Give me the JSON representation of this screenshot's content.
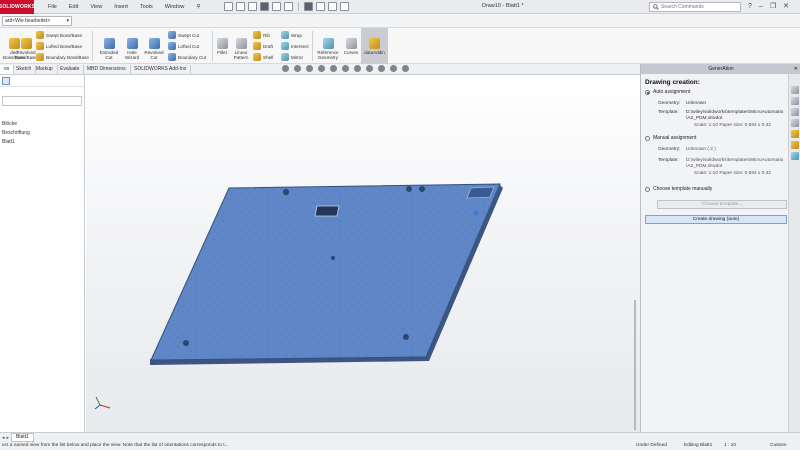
{
  "app": {
    "logo_text": "SOLIDWORKS",
    "menu": [
      "File",
      "Edit",
      "View",
      "Insert",
      "Tools",
      "Window"
    ],
    "pin_glyph": "⚲",
    "doc_title": "Draw10 - Blatt1 *",
    "search_placeholder": "Search Commands",
    "window_controls": [
      "?",
      "–",
      "❐",
      "✕"
    ]
  },
  "config": {
    "current": "ard<Wie bearbeitet>"
  },
  "ribbon": {
    "large": [
      {
        "label": "ded\nBoss/Base",
        "icon": "extrude-icon"
      },
      {
        "label": "Revolved\nBoss/Base",
        "icon": "revolve-icon"
      },
      {
        "label": "Extruded\nCut",
        "icon": "extruded-cut-icon"
      },
      {
        "label": "Hole\nWizard",
        "icon": "hole-wizard-icon"
      },
      {
        "label": "Revolved\nCut",
        "icon": "revolved-cut-icon"
      },
      {
        "label": "Fillet",
        "icon": "fillet-icon"
      },
      {
        "label": "Linear\nPattern",
        "icon": "linear-pattern-icon"
      },
      {
        "label": "Reference\nGeometry",
        "icon": "reference-geometry-icon"
      },
      {
        "label": "Curves",
        "icon": "curves-icon"
      },
      {
        "label": "dataAddin",
        "icon": "addin-icon"
      }
    ],
    "small": [
      {
        "label": "Swept Boss/Base",
        "icon": "swept-boss-icon"
      },
      {
        "label": "Lofted Boss/Base",
        "icon": "lofted-boss-icon"
      },
      {
        "label": "Boundary Boss/Base",
        "icon": "boundary-boss-icon"
      },
      {
        "label": "Swept Cut",
        "icon": "swept-cut-icon"
      },
      {
        "label": "Lofted Cut",
        "icon": "lofted-cut-icon"
      },
      {
        "label": "Boundary Cut",
        "icon": "boundary-cut-icon"
      },
      {
        "label": "Rib",
        "icon": "rib-icon"
      },
      {
        "label": "Draft",
        "icon": "draft-icon"
      },
      {
        "label": "Shell",
        "icon": "shell-icon"
      },
      {
        "label": "Wrap",
        "icon": "wrap-icon"
      },
      {
        "label": "Intersect",
        "icon": "intersect-icon"
      },
      {
        "label": "Mirror",
        "icon": "mirror-icon"
      }
    ]
  },
  "tabs": [
    "es",
    "Sketch",
    "Markup",
    "Evaluate",
    "MBD Dimensions",
    "SOLIDWORKS Add-Ins"
  ],
  "tree": {
    "items": [
      "Blöcke",
      "Beschriftung",
      "Blatt1"
    ]
  },
  "taskpane": {
    "header": "GenerAtion",
    "close_glyph": "✕",
    "title": "Drawing creation:",
    "auto": {
      "label": "Auto assignment",
      "geometry_label": "Geometry:",
      "geometry_value": "Unknown",
      "template_label": "Template:",
      "template_value_1": "D:\\wiley\\solidworks\\templates\\MicroAutomatio",
      "template_value_2": "\\A2_PDM.drwdot",
      "scale": "Scale: 1:10  Paper size: 0.594 x 0.42"
    },
    "manual": {
      "label": "Manual assignment",
      "geometry_label": "Geometry:",
      "geometry_value": "Unknown ( 2 )",
      "template_label": "Template:",
      "template_value_1": "D:\\wiley\\solidworks\\templates\\MicroAutomatio",
      "template_value_2": "\\A2_PDM.drwdot",
      "scale": "Scale: 1:10  Paper size: 0.594 x 0.42"
    },
    "choose_label": "Choose template manually",
    "choose_button": "Choose template...",
    "create_button": "Create drawing (auto)"
  },
  "statusbar": {
    "sheet_tab": "Blatt1",
    "message": "ect a named view from the list below and place the view. Note that the list of orientations corresponds to t...",
    "under_defined": "Under Defined",
    "editing": "Editing Blatt1",
    "scale": "1 : 10",
    "custom": "Custom"
  }
}
